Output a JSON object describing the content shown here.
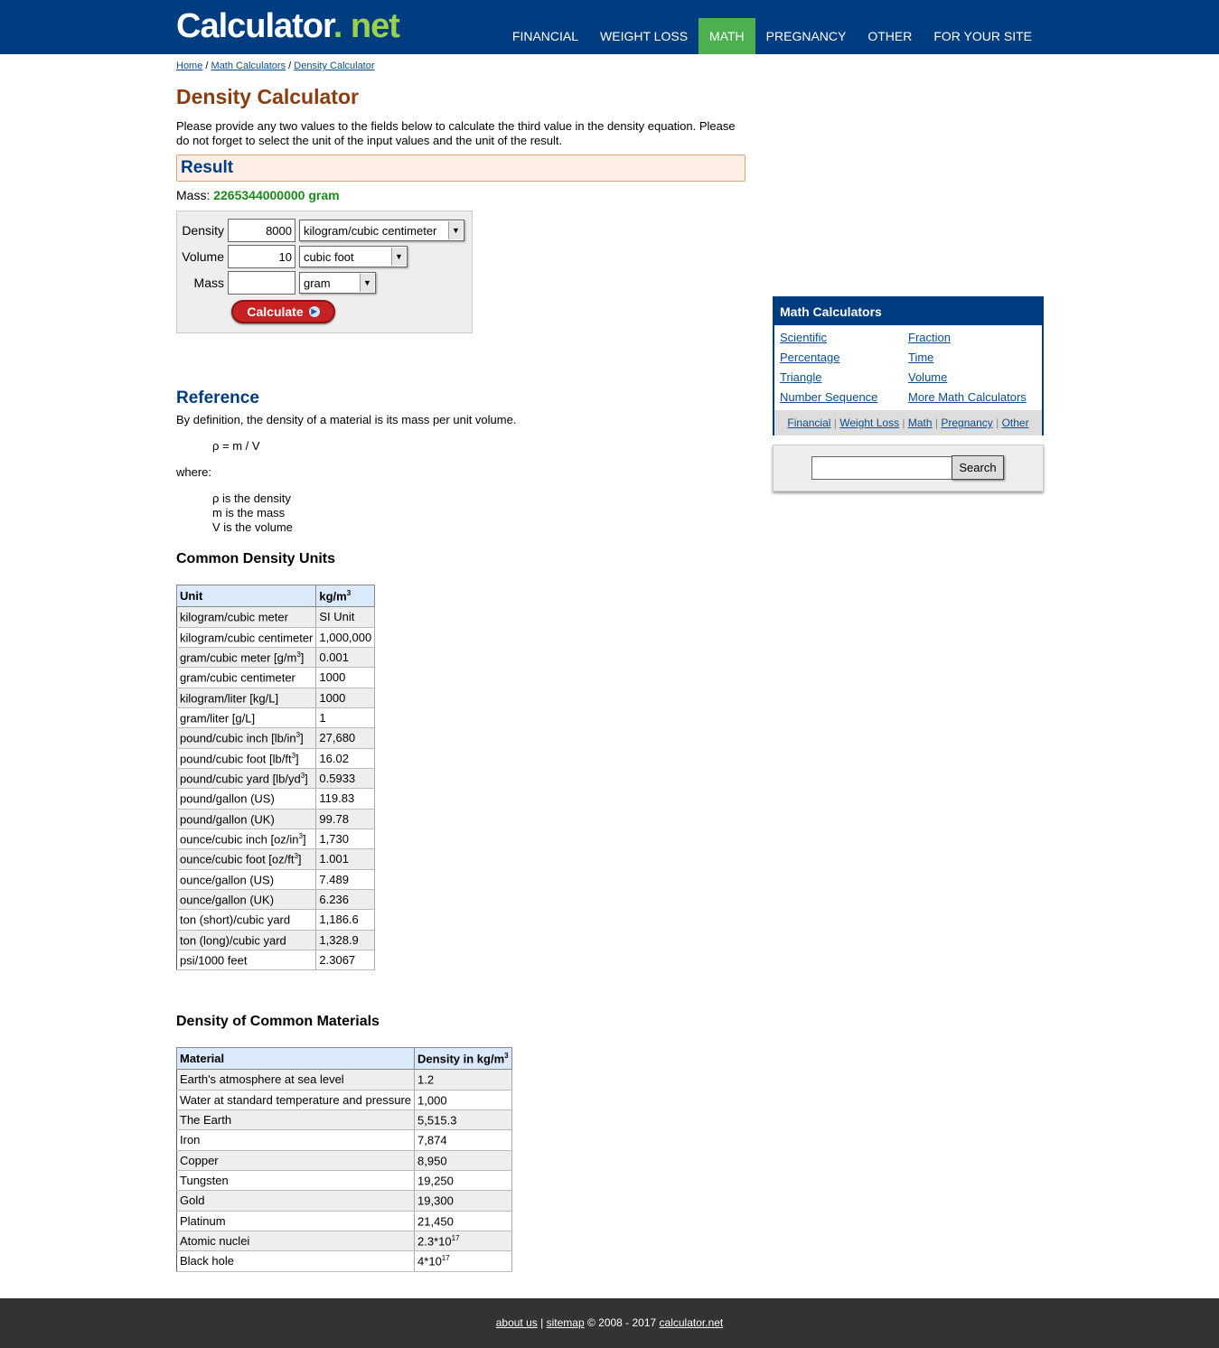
{
  "header": {
    "logo_main": "Calculator",
    "logo_dot": ".",
    "logo_tld": "net",
    "nav": [
      "FINANCIAL",
      "WEIGHT LOSS",
      "MATH",
      "PREGNANCY",
      "OTHER",
      "FOR YOUR SITE"
    ]
  },
  "breadcrumb": {
    "home": "Home",
    "math": "Math Calculators",
    "current": "Density Calculator",
    "sep": "/"
  },
  "page_title": "Density Calculator",
  "intro": "Please provide any two values to the fields below to calculate the third value in the density equation. Please do not forget to select the unit of the input values and the unit of the result.",
  "result": {
    "heading": "Result",
    "label": "Mass:",
    "value": "2265344000000 gram"
  },
  "calculator": {
    "density_label": "Density",
    "density_value": "8000",
    "density_unit": "kilogram/cubic centimeter",
    "volume_label": "Volume",
    "volume_value": "10",
    "volume_unit": "cubic foot",
    "mass_label": "Mass",
    "mass_value": "",
    "mass_unit": "gram",
    "button": "Calculate"
  },
  "reference": {
    "heading": "Reference",
    "definition": "By definition, the density of a material is its mass per unit volume.",
    "formula": "ρ = m / V",
    "where": "where:",
    "vars": [
      "ρ is the density",
      "m is the mass",
      "V is the volume"
    ]
  },
  "units_table": {
    "heading": "Common Density Units",
    "col_unit": "Unit",
    "col_value": "kg/m",
    "col_value_sup": "3",
    "rows": [
      {
        "unit": "kilogram/cubic meter",
        "sup": "",
        "tail": "",
        "value": "SI Unit"
      },
      {
        "unit": "kilogram/cubic centimeter",
        "sup": "",
        "tail": "",
        "value": "1,000,000"
      },
      {
        "unit": "gram/cubic meter [g/m",
        "sup": "3",
        "tail": "]",
        "value": "0.001"
      },
      {
        "unit": "gram/cubic centimeter",
        "sup": "",
        "tail": "",
        "value": "1000"
      },
      {
        "unit": "kilogram/liter [kg/L]",
        "sup": "",
        "tail": "",
        "value": "1000"
      },
      {
        "unit": "gram/liter [g/L]",
        "sup": "",
        "tail": "",
        "value": "1"
      },
      {
        "unit": "pound/cubic inch [lb/in",
        "sup": "3",
        "tail": "]",
        "value": "27,680"
      },
      {
        "unit": "pound/cubic foot [lb/ft",
        "sup": "3",
        "tail": "]",
        "value": "16.02"
      },
      {
        "unit": "pound/cubic yard [lb/yd",
        "sup": "3",
        "tail": "]",
        "value": "0.5933"
      },
      {
        "unit": "pound/gallon (US)",
        "sup": "",
        "tail": "",
        "value": "119.83"
      },
      {
        "unit": "pound/gallon (UK)",
        "sup": "",
        "tail": "",
        "value": "99.78"
      },
      {
        "unit": "ounce/cubic inch [oz/in",
        "sup": "3",
        "tail": "]",
        "value": "1,730"
      },
      {
        "unit": "ounce/cubic foot [oz/ft",
        "sup": "3",
        "tail": "]",
        "value": "1.001"
      },
      {
        "unit": "ounce/gallon (US)",
        "sup": "",
        "tail": "",
        "value": "7.489"
      },
      {
        "unit": "ounce/gallon (UK)",
        "sup": "",
        "tail": "",
        "value": "6.236"
      },
      {
        "unit": "ton (short)/cubic yard",
        "sup": "",
        "tail": "",
        "value": "1,186.6"
      },
      {
        "unit": "ton (long)/cubic yard",
        "sup": "",
        "tail": "",
        "value": "1,328.9"
      },
      {
        "unit": "psi/1000 feet",
        "sup": "",
        "tail": "",
        "value": "2.3067"
      }
    ]
  },
  "materials_table": {
    "heading": "Density of Common Materials",
    "col_material": "Material",
    "col_density": "Density in kg/m",
    "col_density_sup": "3",
    "rows": [
      {
        "material": "Earth's atmosphere at sea level",
        "value": "1.2",
        "sup": ""
      },
      {
        "material": "Water at standard temperature and pressure",
        "value": "1,000",
        "sup": ""
      },
      {
        "material": "The Earth",
        "value": "5,515.3",
        "sup": ""
      },
      {
        "material": "Iron",
        "value": "7,874",
        "sup": ""
      },
      {
        "material": "Copper",
        "value": "8,950",
        "sup": ""
      },
      {
        "material": "Tungsten",
        "value": "19,250",
        "sup": ""
      },
      {
        "material": "Gold",
        "value": "19,300",
        "sup": ""
      },
      {
        "material": "Platinum",
        "value": "21,450",
        "sup": ""
      },
      {
        "material": "Atomic nuclei",
        "value": "2.3*10",
        "sup": "17"
      },
      {
        "material": "Black hole",
        "value": "4*10",
        "sup": "17"
      }
    ]
  },
  "sidebar": {
    "heading": "Math Calculators",
    "links": [
      "Scientific",
      "Fraction",
      "Percentage",
      "Time",
      "Triangle",
      "Volume",
      "Number Sequence",
      "More Math Calculators"
    ],
    "footer_links": [
      "Financial",
      "Weight Loss",
      "Math",
      "Pregnancy",
      "Other"
    ],
    "footer_sep": "|"
  },
  "search": {
    "button": "Search",
    "value": ""
  },
  "footer": {
    "about": "about us",
    "sep": "|",
    "sitemap": "sitemap",
    "copyright": "© 2008 - 2017",
    "site": "calculator.net"
  }
}
